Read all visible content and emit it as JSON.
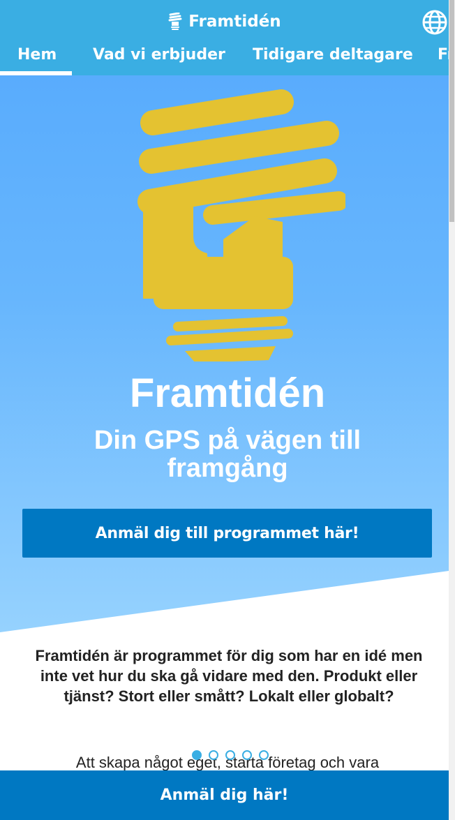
{
  "header": {
    "brand_name": "Framtidén",
    "brand_icon": "lightbulb-icon",
    "language_icon": "globe-icon"
  },
  "nav": {
    "tabs": [
      {
        "label": "Hem",
        "active": true
      },
      {
        "label": "Vad vi erbjuder"
      },
      {
        "label": "Tidigare deltagare"
      },
      {
        "label": "Fr"
      }
    ]
  },
  "hero": {
    "title": "Framtidén",
    "subtitle": "Din GPS på vägen till framgång",
    "cta_label": "Anmäl dig till programmet här!"
  },
  "intro": {
    "text": "Framtidén är programmet för dig som har en idé men inte vet hur du ska gå vidare med den. Produkt eller tjänst? Stort eller smått? Lokalt eller globalt?",
    "partial_text": "Att skapa något eget, starta företag och vara"
  },
  "carousel": {
    "count": 5,
    "active_index": 0
  },
  "bottom_bar": {
    "label": "Anmäl dig här!"
  },
  "colors": {
    "header_bg": "#3aaee3",
    "accent": "#0078c2",
    "bulb": "#e4c231"
  }
}
